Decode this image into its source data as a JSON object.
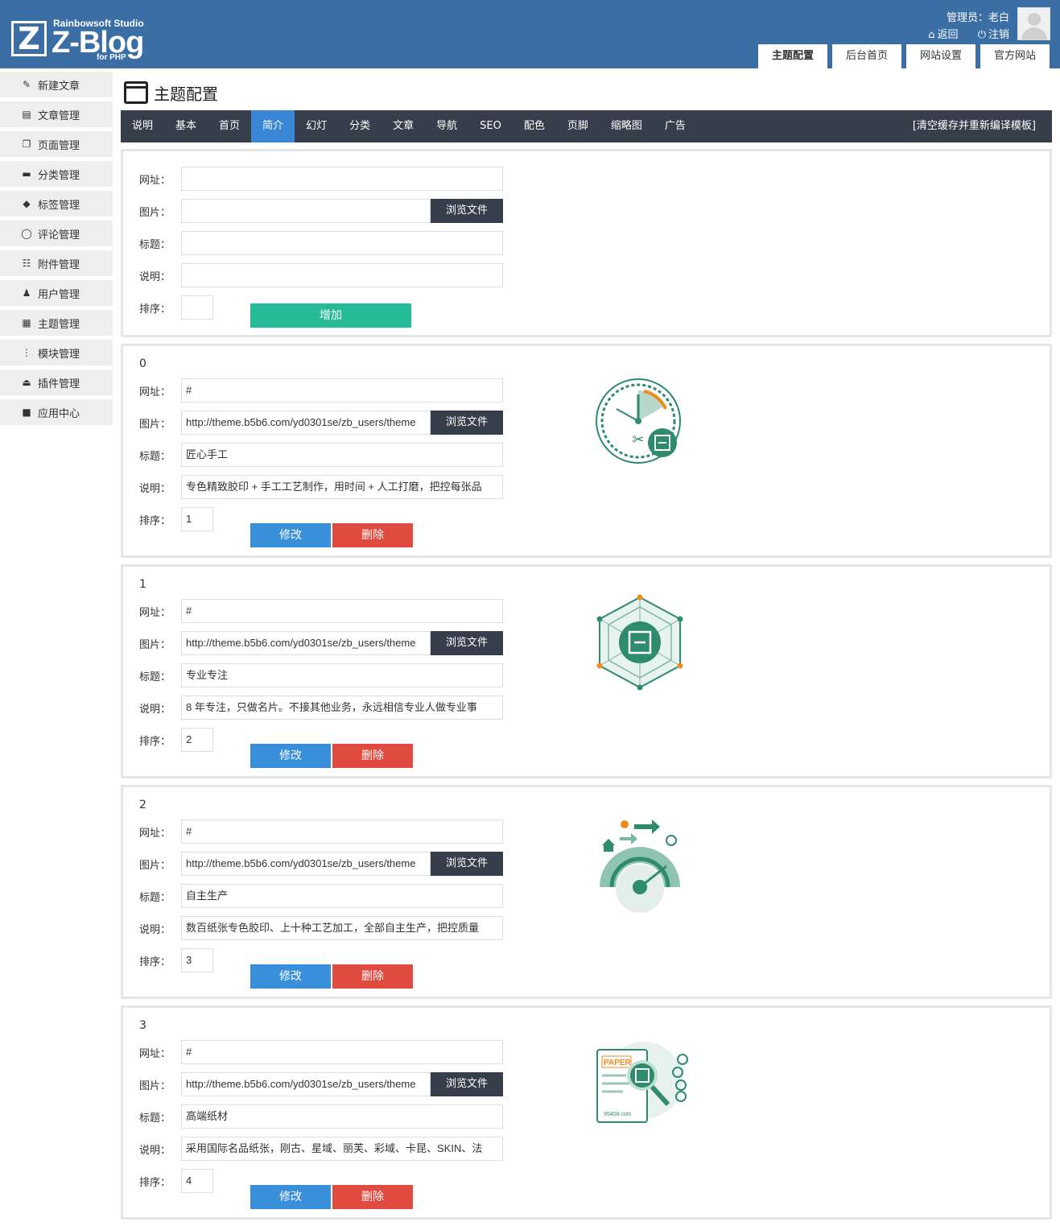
{
  "header": {
    "logo": {
      "studio": "Rainbowsoft Studio",
      "brand": "Z-Blog",
      "sub": "for PHP",
      "mark": "Z"
    },
    "user_line": "管理员：老白",
    "back_label": "返回",
    "logout_label": "注销",
    "nav": [
      "主题配置",
      "后台首页",
      "网站设置",
      "官方网站"
    ]
  },
  "sidebar": {
    "items": [
      {
        "label": "新建文章",
        "icon": "edit-icon"
      },
      {
        "label": "文章管理",
        "icon": "document-icon"
      },
      {
        "label": "页面管理",
        "icon": "pages-icon"
      },
      {
        "label": "分类管理",
        "icon": "folder-icon"
      },
      {
        "label": "标签管理",
        "icon": "tag-icon"
      },
      {
        "label": "评论管理",
        "icon": "comment-icon"
      },
      {
        "label": "附件管理",
        "icon": "attachment-icon"
      },
      {
        "label": "用户管理",
        "icon": "user-icon"
      },
      {
        "label": "主题管理",
        "icon": "theme-icon"
      },
      {
        "label": "模块管理",
        "icon": "module-icon"
      },
      {
        "label": "插件管理",
        "icon": "plugin-icon"
      },
      {
        "label": "应用中心",
        "icon": "cube-icon"
      }
    ]
  },
  "page": {
    "title": "主题配置"
  },
  "tabs": {
    "items": [
      "说明",
      "基本",
      "首页",
      "简介",
      "幻灯",
      "分类",
      "文章",
      "导航",
      "SEO",
      "配色",
      "页脚",
      "缩略图",
      "广告"
    ],
    "active": "简介",
    "clear_cache": "[清空缓存并重新编译模板]"
  },
  "form": {
    "labels": {
      "url": "网址：",
      "image": "图片：",
      "title": "标题：",
      "desc": "说明：",
      "order": "排序："
    },
    "browse_label": "浏览文件",
    "add_label": "增加",
    "edit_label": "修改",
    "delete_label": "删除"
  },
  "entries": [
    {
      "index": "0",
      "url": "#",
      "image": "http://theme.b5b6.com/yd0301se/zb_users/theme",
      "title": "匠心手工",
      "desc": "专色精致胶印 + 手工工艺制作，用时间 + 人工打磨，把控每张品",
      "order": "1",
      "icon": "clock-tools-icon"
    },
    {
      "index": "1",
      "url": "#",
      "image": "http://theme.b5b6.com/yd0301se/zb_users/theme",
      "title": "专业专注",
      "desc": "8 年专注，只做名片。不接其他业务，永远相信专业人做专业事",
      "order": "2",
      "icon": "hexagon-network-icon"
    },
    {
      "index": "2",
      "url": "#",
      "image": "http://theme.b5b6.com/yd0301se/zb_users/theme",
      "title": "自主生产",
      "desc": "数百纸张专色胶印、上十种工艺加工，全部自主生产，把控质量",
      "order": "3",
      "icon": "gauge-icon"
    },
    {
      "index": "3",
      "url": "#",
      "image": "http://theme.b5b6.com/yd0301se/zb_users/theme",
      "title": "高端纸材",
      "desc": "采用国际名品纸张，刚古、星域、丽芙、彩域、卡昆、SKIN、法",
      "order": "4",
      "icon": "paper-magnifier-icon",
      "icon_text": [
        "PAPER",
        "95408.com"
      ]
    }
  ],
  "colors": {
    "header": "#3a6ea5",
    "tabbar": "#353e4a",
    "tab_active": "#3a86d6",
    "add": "#24bb96",
    "edit": "#3a8fdb",
    "delete": "#e04a3f",
    "icon_green": "#2e8b6e",
    "icon_orange": "#f08c1e"
  }
}
